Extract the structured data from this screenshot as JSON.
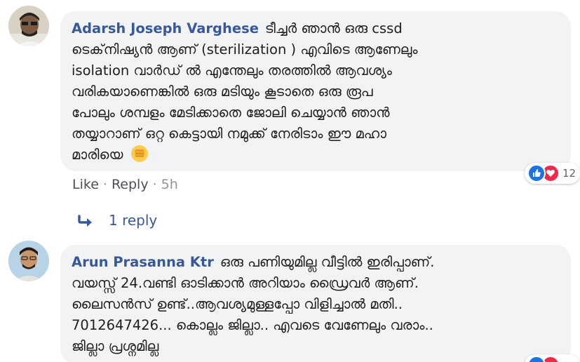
{
  "comments": [
    {
      "author": "Adarsh Joseph Varghese",
      "lines": [
        "ടീച്ചർ ഞാൻ ഒരു cssd",
        "ടെക്‌നിഷ്യൻ ആണ് (sterilization ) എവിടെ ആണേലും",
        "isolation വാർഡ് ൽ എന്തേലും തരത്തിൽ ആവശ്യം",
        "വരികയാണെങ്കിൽ ഒരു മടിയും കൂടാതെ ഒരു രൂപ",
        "പോലും ശമ്പളം മേടിക്കാതെ ജോലി ചെയ്യാൻ ഞാൻ",
        "തയ്യാറാണ് ഒറ്റ കെട്ടായി നമുക്ക് നേരിടാം ഈ മഹാ",
        "മാരിയെ"
      ],
      "emoji": "fist-emoji",
      "reaction_count": "12",
      "actions": {
        "like": "Like",
        "reply": "Reply",
        "time": "5h"
      },
      "replies_label": "1 reply"
    },
    {
      "author": "Arun Prasanna Ktr",
      "lines": [
        "ഒരു പണിയുമില്ല വീട്ടിൽ ഇരിപ്പാണ്.",
        "വയസ്സ് 24.വണ്ടി ഓടിക്കാൻ അറിയാം ഡ്രൈവർ ആണ്.",
        "ലൈസൻസ് ഉണ്ട്..ആവശ്യമുള്ളപ്പോ വിളിച്ചാൽ മതി..",
        "7012647426... കൊല്ലം ജില്ലാ.. എവടെ വേണേലും വരാം..",
        "ജില്ലാ പ്രശ്നമില്ല"
      ]
    }
  ],
  "colors": {
    "author": "#385898",
    "bubble": "#f2f3f5",
    "like_reaction": "#1b74e4",
    "love_reaction": "#f0284a",
    "meta": "#90949c"
  }
}
